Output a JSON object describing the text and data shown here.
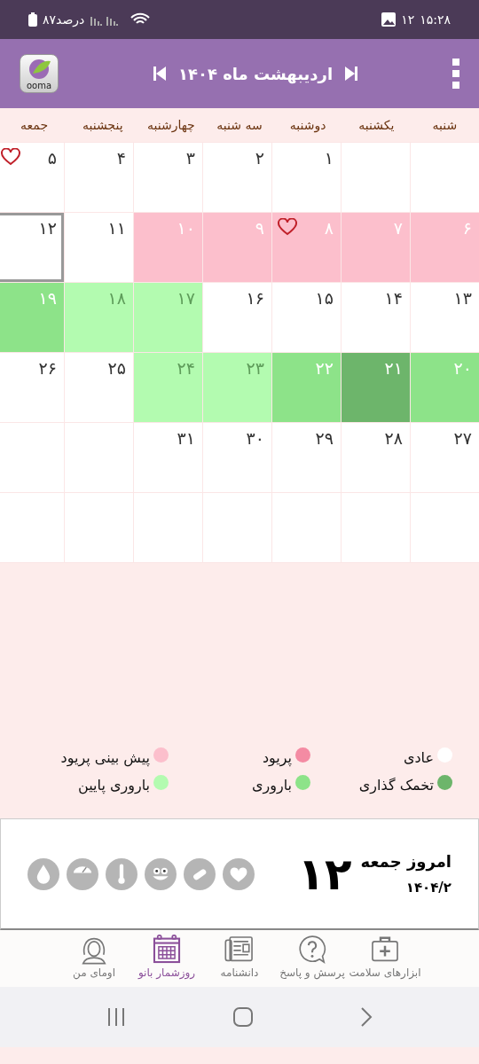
{
  "status_bar": {
    "battery": "۸۷درصد",
    "notification_count": "۱۲",
    "time": "۱۵:۲۸"
  },
  "header": {
    "logo": "ooma",
    "title": "اردیبهشت ماه ۱۴۰۴"
  },
  "weekdays": [
    "شنبه",
    "یکشنبه",
    "دوشنبه",
    "سه شنبه",
    "چهارشنبه",
    "پنجشنبه",
    "جمعه"
  ],
  "weeks": [
    {
      "days": [
        {
          "kind": "normal",
          "selected": false,
          "heart": false
        },
        {
          "kind": "normal",
          "selected": false,
          "heart": false
        },
        {
          "day": "۱",
          "kind": "normal",
          "selected": false,
          "heart": false
        },
        {
          "day": "۲",
          "kind": "normal",
          "selected": false,
          "heart": false
        },
        {
          "day": "۳",
          "kind": "normal",
          "selected": false,
          "heart": false
        },
        {
          "day": "۴",
          "kind": "normal",
          "selected": false,
          "heart": false
        },
        {
          "day": "۵",
          "kind": "normal",
          "selected": false,
          "heart": true
        }
      ]
    },
    {
      "days": [
        {
          "day": "۶",
          "kind": "predicted_period",
          "selected": false,
          "heart": false
        },
        {
          "day": "۷",
          "kind": "predicted_period",
          "selected": false,
          "heart": false
        },
        {
          "day": "۸",
          "kind": "predicted_period",
          "selected": false,
          "heart": true
        },
        {
          "day": "۹",
          "kind": "predicted_period",
          "selected": false,
          "heart": false
        },
        {
          "day": "۱۰",
          "kind": "predicted_period",
          "selected": false,
          "heart": false
        },
        {
          "day": "۱۱",
          "kind": "normal",
          "selected": false,
          "heart": false
        },
        {
          "day": "۱۲",
          "kind": "normal",
          "selected": true,
          "heart": false
        }
      ]
    },
    {
      "days": [
        {
          "day": "۱۳",
          "kind": "normal",
          "selected": false,
          "heart": false
        },
        {
          "day": "۱۴",
          "kind": "normal",
          "selected": false,
          "heart": false
        },
        {
          "day": "۱۵",
          "kind": "normal",
          "selected": false,
          "heart": false
        },
        {
          "day": "۱۶",
          "kind": "normal",
          "selected": false,
          "heart": false
        },
        {
          "day": "۱۷",
          "kind": "low_fertility",
          "selected": false,
          "heart": false
        },
        {
          "day": "۱۸",
          "kind": "low_fertility",
          "selected": false,
          "heart": false
        },
        {
          "day": "۱۹",
          "kind": "fertility",
          "selected": false,
          "heart": false
        }
      ]
    },
    {
      "days": [
        {
          "day": "۲۰",
          "kind": "fertility",
          "selected": false,
          "heart": false
        },
        {
          "day": "۲۱",
          "kind": "ovulation",
          "selected": false,
          "heart": false
        },
        {
          "day": "۲۲",
          "kind": "fertility",
          "selected": false,
          "heart": false
        },
        {
          "day": "۲۳",
          "kind": "low_fertility",
          "selected": false,
          "heart": false
        },
        {
          "day": "۲۴",
          "kind": "low_fertility",
          "selected": false,
          "heart": false
        },
        {
          "day": "۲۵",
          "kind": "normal",
          "selected": false,
          "heart": false
        },
        {
          "day": "۲۶",
          "kind": "normal",
          "selected": false,
          "heart": false
        }
      ]
    },
    {
      "days": [
        {
          "day": "۲۷",
          "kind": "normal",
          "selected": false,
          "heart": false
        },
        {
          "day": "۲۸",
          "kind": "normal",
          "selected": false,
          "heart": false
        },
        {
          "day": "۲۹",
          "kind": "normal",
          "selected": false,
          "heart": false
        },
        {
          "day": "۳۰",
          "kind": "normal",
          "selected": false,
          "heart": false
        },
        {
          "day": "۳۱",
          "kind": "normal",
          "selected": false,
          "heart": false
        },
        {
          "kind": "normal",
          "selected": false,
          "heart": false
        },
        {
          "kind": "normal",
          "selected": false,
          "heart": false
        }
      ]
    },
    {
      "days": [
        {
          "kind": "normal",
          "selected": false,
          "heart": false
        },
        {
          "kind": "normal",
          "selected": false,
          "heart": false
        },
        {
          "kind": "normal",
          "selected": false,
          "heart": false
        },
        {
          "kind": "normal",
          "selected": false,
          "heart": false
        },
        {
          "kind": "normal",
          "selected": false,
          "heart": false
        },
        {
          "kind": "normal",
          "selected": false,
          "heart": false
        },
        {
          "kind": "normal",
          "selected": false,
          "heart": false
        }
      ]
    }
  ],
  "legend": [
    {
      "label": "عادی",
      "color": "#ffffff"
    },
    {
      "label": "پریود",
      "color": "#f48ba3"
    },
    {
      "label": "پیش بینی پریود",
      "color": "#fcbfcc"
    },
    {
      "label": "تخمک گذاری",
      "color": "#6db56b"
    },
    {
      "label": "باروری",
      "color": "#8de389"
    },
    {
      "label": "باروری پایین",
      "color": "#b3fbb0"
    }
  ],
  "today": {
    "label": "امروز جمعه",
    "date": "۱۴۰۴/۲",
    "day": "۱۲"
  },
  "nav": [
    {
      "label": "ابزارهای سلامت",
      "selected": false
    },
    {
      "label": "پرسش و پاسخ",
      "selected": false
    },
    {
      "label": "دانشنامه",
      "selected": false
    },
    {
      "label": "روزشمار بانو",
      "selected": true
    },
    {
      "label": "اومای من",
      "selected": false
    }
  ]
}
